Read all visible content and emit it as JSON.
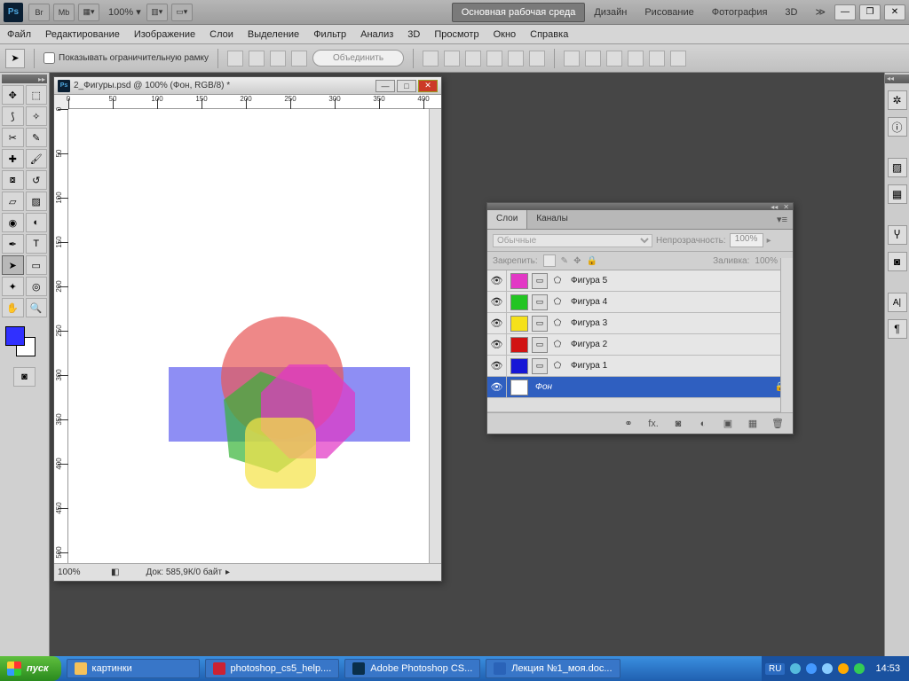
{
  "titlebar": {
    "logo": "Ps",
    "br": "Br",
    "mb": "Mb",
    "zoom": "100%",
    "workspaces": [
      "Основная рабочая среда",
      "Дизайн",
      "Рисование",
      "Фотография",
      "3D"
    ],
    "more": "≫"
  },
  "menu": [
    "Файл",
    "Редактирование",
    "Изображение",
    "Слои",
    "Выделение",
    "Фильтр",
    "Анализ",
    "3D",
    "Просмотр",
    "Окно",
    "Справка"
  ],
  "options": {
    "show_bbox": "Показывать ограничительную рамку",
    "merge": "Объединить"
  },
  "doc": {
    "title": "2_Фигуры.psd @ 100% (Фон, RGB/8) *",
    "zoom": "100%",
    "info": "Док: 585,9К/0 байт"
  },
  "layers_panel": {
    "tabs": [
      "Слои",
      "Каналы"
    ],
    "blend_mode": "Обычные",
    "opacity_lbl": "Непрозрачность:",
    "opacity_val": "100%",
    "lock_lbl": "Закрепить:",
    "fill_lbl": "Заливка:",
    "fill_val": "100%",
    "layers": [
      {
        "name": "Фигура 5",
        "color": "#e238c5"
      },
      {
        "name": "Фигура 4",
        "color": "#22c522"
      },
      {
        "name": "Фигура 3",
        "color": "#f5e11a"
      },
      {
        "name": "Фигура 2",
        "color": "#d11313"
      },
      {
        "name": "Фигура 1",
        "color": "#1616d6"
      }
    ],
    "bg_layer": "Фон"
  },
  "taskbar": {
    "start": "пуск",
    "tasks": [
      {
        "label": "картинки",
        "ic": "#f5c15a"
      },
      {
        "label": "photoshop_cs5_help....",
        "ic": "#c23"
      },
      {
        "label": "Adobe Photoshop CS...",
        "ic": "#0a2f4a"
      },
      {
        "label": "Лекция №1_моя.doc...",
        "ic": "#2a63b8"
      }
    ],
    "lang": "RU",
    "time": "14:53"
  }
}
